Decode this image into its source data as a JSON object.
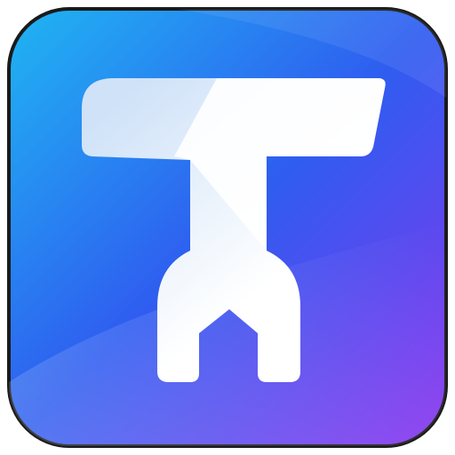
{
  "app_icon": {
    "icon": "t-wrench-icon",
    "colors": {
      "gradient_start": "#1fb6f2",
      "gradient_mid": "#2f5df0",
      "gradient_end": "#8a33ee",
      "outline": "#1a1a1a",
      "glyph_light": "#ffffff",
      "glyph_shade": "#cfe2f8"
    }
  }
}
